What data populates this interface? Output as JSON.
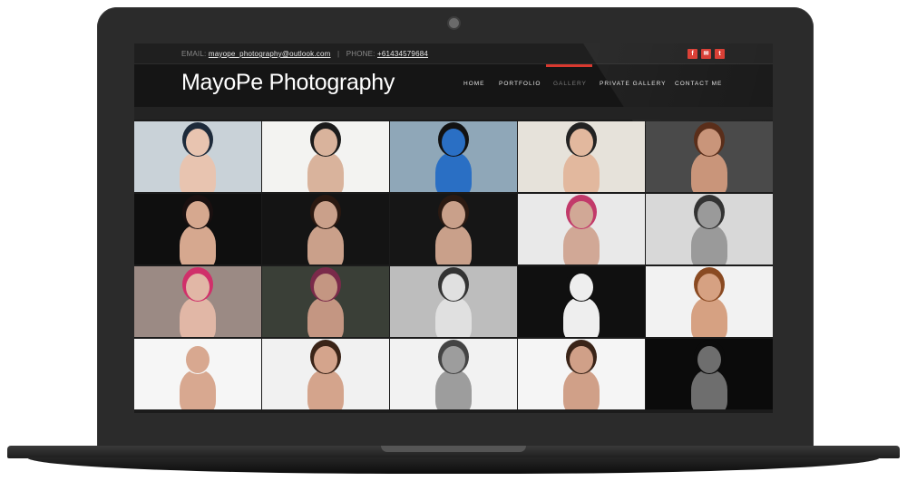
{
  "contact": {
    "email_label": "EMAIL:",
    "email": "mayope_photography@outlook.com",
    "phone_label": "PHONE:",
    "phone": "+61434579684",
    "separator": "|"
  },
  "social": [
    {
      "icon": "facebook-icon",
      "glyph": "f"
    },
    {
      "icon": "mail-icon",
      "glyph": "✉"
    },
    {
      "icon": "tumblr-icon",
      "glyph": "t"
    }
  ],
  "brand": {
    "logo_text": "MayoPe Photography"
  },
  "nav": [
    {
      "label": "HOME",
      "active": false
    },
    {
      "label": "PORTFOLIO",
      "active": false
    },
    {
      "label": "GALLERY",
      "active": true
    },
    {
      "label": "PRIVATE GALLERY",
      "active": false
    },
    {
      "label": "CONTACT ME",
      "active": false
    }
  ],
  "colors": {
    "accent": "#d8392f",
    "header_bg": "#151515",
    "topbar_bg": "#1f1f1f"
  },
  "gallery": {
    "photos": [
      {
        "name": "beach-reclining-rainbow",
        "bg": "#c9d2d8",
        "fig": "#e8c4b0",
        "hair": "#1d2a3a"
      },
      {
        "name": "beach-rainbow-sarong",
        "bg": "#f3f3f1",
        "fig": "#d9b39c",
        "hair": "#1b1b1b"
      },
      {
        "name": "blue-sarong-closeup",
        "bg": "#8fa7b8",
        "fig": "#2a6fc4",
        "hair": "#121212"
      },
      {
        "name": "beach-lying-rainbow",
        "bg": "#e6e2da",
        "fig": "#e2b89e",
        "hair": "#222"
      },
      {
        "name": "blue-swimsuit-studio",
        "bg": "#4a4a4a",
        "fig": "#c9957a",
        "hair": "#5a2e1a"
      },
      {
        "name": "dark-studio-laughing",
        "bg": "#0f0f0f",
        "fig": "#d6a88f",
        "hair": "#1a1010"
      },
      {
        "name": "dark-studio-portrait-1",
        "bg": "#141414",
        "fig": "#caa08a",
        "hair": "#2a1810"
      },
      {
        "name": "dark-studio-portrait-2",
        "bg": "#161616",
        "fig": "#c9a08a",
        "hair": "#2b1a12"
      },
      {
        "name": "fence-outdoor-bw",
        "bg": "#e9e9e9",
        "fig": "#d1a896",
        "hair": "#c23a6a"
      },
      {
        "name": "tree-bw-nude",
        "bg": "#d8d8d8",
        "fig": "#9a9a9a",
        "hair": "#333"
      },
      {
        "name": "pink-hair-tattoo",
        "bg": "#9b8a84",
        "fig": "#e1b7a6",
        "hair": "#d0306a"
      },
      {
        "name": "tattoo-forest-sitting",
        "bg": "#3a3f37",
        "fig": "#c49682",
        "hair": "#7a2a4a"
      },
      {
        "name": "birch-forest-bw",
        "bg": "#bdbdbd",
        "fig": "#e0e0e0",
        "hair": "#333"
      },
      {
        "name": "white-fabric-dark",
        "bg": "#101010",
        "fig": "#eeeeee",
        "hair": "#101010"
      },
      {
        "name": "white-backdrop-pose",
        "bg": "#f2f2f2",
        "fig": "#d6a182",
        "hair": "#8a4a22"
      },
      {
        "name": "black-dress-white-1",
        "bg": "#f6f6f6",
        "fig": "#d8a890",
        "hair": "#f6f6f6"
      },
      {
        "name": "black-dress-portrait",
        "bg": "#f1f1f1",
        "fig": "#d4a48c",
        "hair": "#3a2418"
      },
      {
        "name": "bw-covered-pose",
        "bg": "#f2f2f2",
        "fig": "#9d9d9d",
        "hair": "#444"
      },
      {
        "name": "black-dress-white-2",
        "bg": "#f5f5f5",
        "fig": "#d0a088",
        "hair": "#3a2418"
      },
      {
        "name": "silhouette-dark",
        "bg": "#0b0b0b",
        "fig": "#6e6e6e",
        "hair": "#0b0b0b"
      }
    ]
  }
}
